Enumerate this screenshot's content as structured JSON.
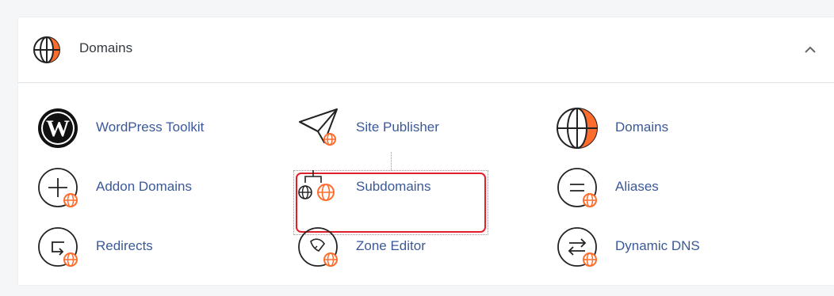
{
  "section": {
    "title": "Domains",
    "icon": "globe-icon",
    "collapse_icon": "chevron-up-icon"
  },
  "colors": {
    "accent": "#ff6c2c",
    "link": "#3b5998",
    "highlight": "#e0202a"
  },
  "items": [
    {
      "label": "WordPress Toolkit",
      "icon": "wordpress-icon"
    },
    {
      "label": "Site Publisher",
      "icon": "paper-plane-globe-icon"
    },
    {
      "label": "Domains",
      "icon": "globe-icon"
    },
    {
      "label": "Addon Domains",
      "icon": "plus-globe-icon"
    },
    {
      "label": "Subdomains",
      "icon": "subdomain-globes-icon"
    },
    {
      "label": "Aliases",
      "icon": "equals-globe-icon"
    },
    {
      "label": "Redirects",
      "icon": "redirect-arrow-globe-icon"
    },
    {
      "label": "Zone Editor",
      "icon": "rocket-globe-icon"
    },
    {
      "label": "Dynamic DNS",
      "icon": "swap-arrows-globe-icon"
    }
  ]
}
